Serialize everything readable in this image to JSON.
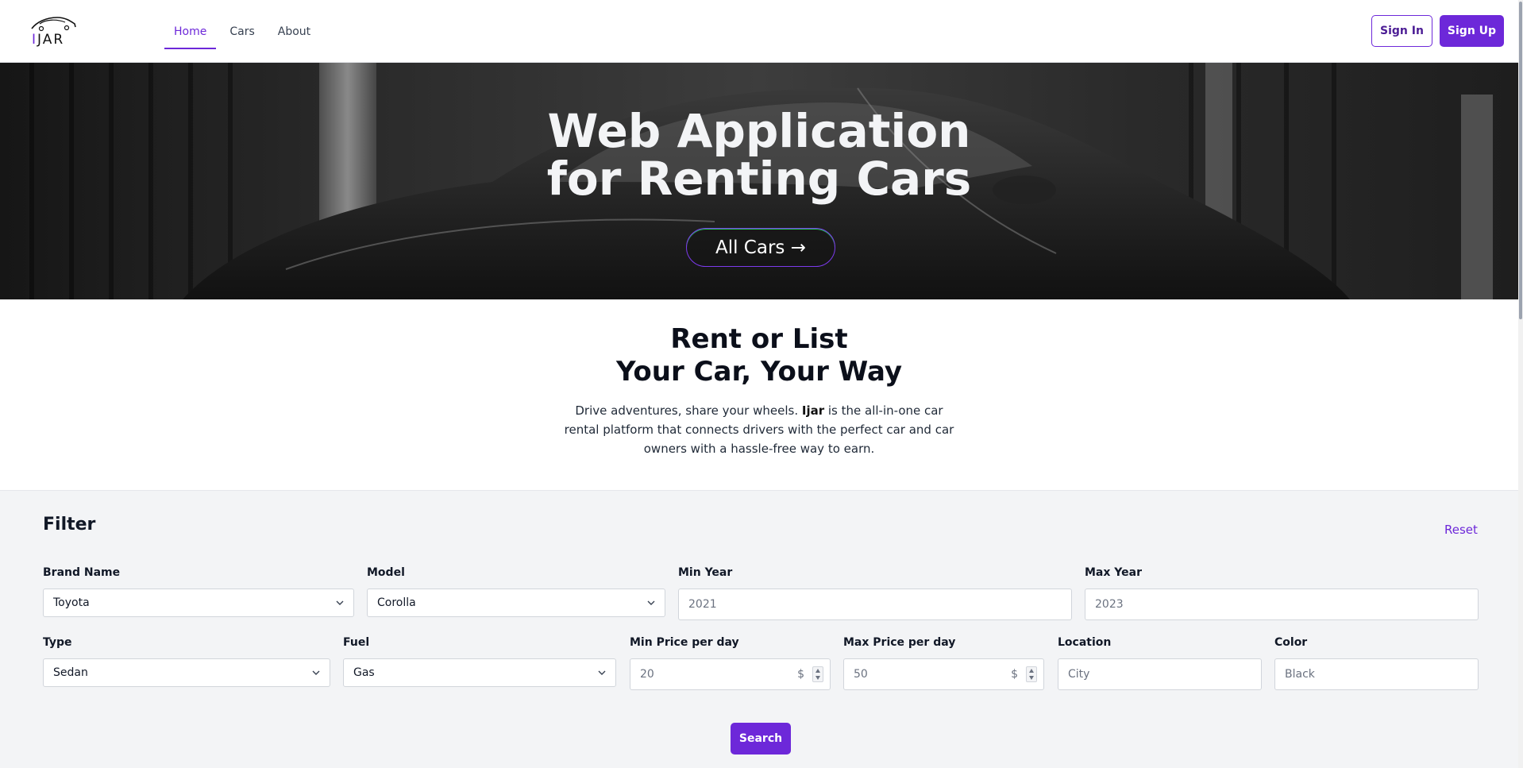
{
  "header": {
    "logo": {
      "text_accent": "I",
      "text_rest": "JAR"
    },
    "nav": [
      {
        "label": "Home",
        "active": true
      },
      {
        "label": "Cars",
        "active": false
      },
      {
        "label": "About",
        "active": false
      }
    ],
    "sign_in_label": "Sign In",
    "sign_up_label": "Sign Up"
  },
  "hero": {
    "title_line1": "Web Application",
    "title_line2": "for Renting Cars",
    "cta_label": "All Cars →"
  },
  "intro": {
    "title_line1": "Rent or List",
    "title_line2": "Your Car, Your Way",
    "text_before": "Drive adventures, share your wheels. ",
    "brand": "Ijar",
    "text_after": " is the all-in-one car rental platform that connects drivers with the perfect car and car owners with a hassle-free way to earn."
  },
  "filter": {
    "title": "Filter",
    "reset_label": "Reset",
    "brand": {
      "label": "Brand Name",
      "value": "Toyota"
    },
    "model": {
      "label": "Model",
      "value": "Corolla"
    },
    "min_year": {
      "label": "Min Year",
      "placeholder": "2021"
    },
    "max_year": {
      "label": "Max Year",
      "placeholder": "2023"
    },
    "type": {
      "label": "Type",
      "value": "Sedan"
    },
    "fuel": {
      "label": "Fuel",
      "value": "Gas"
    },
    "min_price": {
      "label": "Min Price per day",
      "placeholder": "20",
      "unit": "$"
    },
    "max_price": {
      "label": "Max Price per day",
      "placeholder": "50",
      "unit": "$"
    },
    "location": {
      "label": "Location",
      "placeholder": "City"
    },
    "color": {
      "label": "Color",
      "placeholder": "Black"
    },
    "search_label": "Search"
  },
  "colors": {
    "accent": "#6d28d9",
    "filter_bg": "#f3f4f6"
  }
}
